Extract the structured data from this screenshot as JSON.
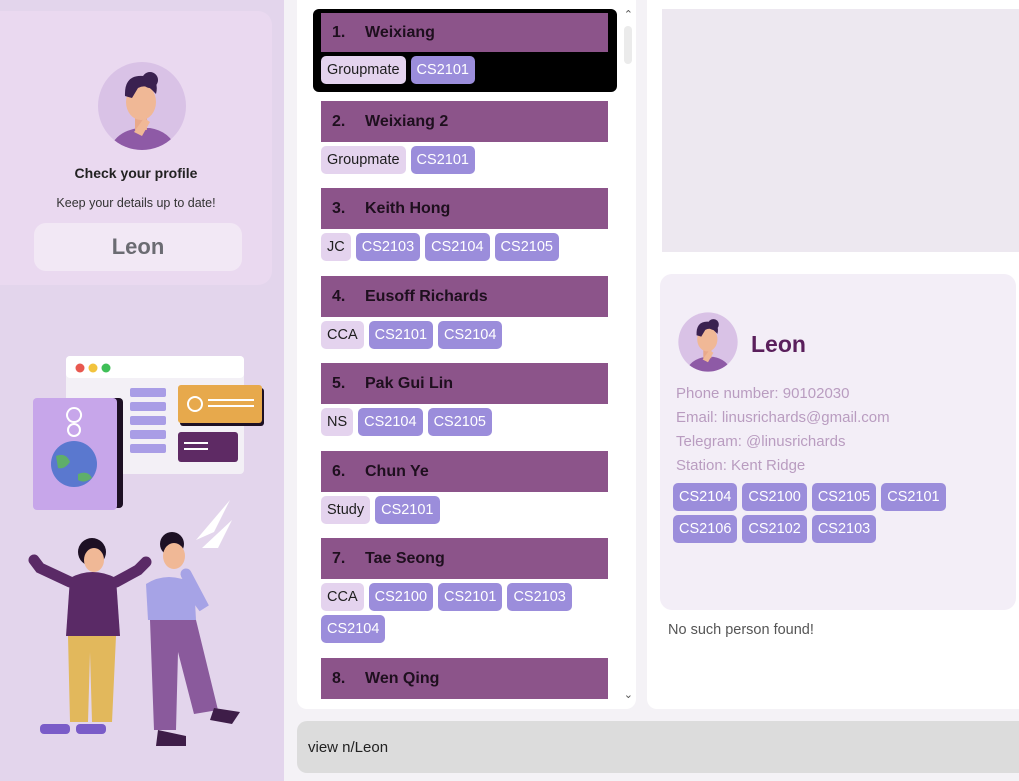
{
  "profile": {
    "heading": "Check your profile",
    "subtitle": "Keep your details up to date!",
    "name": "Leon"
  },
  "persons": [
    {
      "index": "1.",
      "name": "Weixiang",
      "tags": [
        {
          "text": "Groupmate",
          "kind": "text"
        },
        {
          "text": "CS2101",
          "kind": "mod"
        }
      ]
    },
    {
      "index": "2.",
      "name": "Weixiang 2",
      "tags": [
        {
          "text": "Groupmate",
          "kind": "text"
        },
        {
          "text": "CS2101",
          "kind": "mod"
        }
      ]
    },
    {
      "index": "3.",
      "name": "Keith Hong",
      "tags": [
        {
          "text": "JC",
          "kind": "text"
        },
        {
          "text": "CS2103",
          "kind": "mod"
        },
        {
          "text": "CS2104",
          "kind": "mod"
        },
        {
          "text": "CS2105",
          "kind": "mod"
        }
      ]
    },
    {
      "index": "4.",
      "name": "Eusoff Richards",
      "tags": [
        {
          "text": "CCA",
          "kind": "text"
        },
        {
          "text": "CS2101",
          "kind": "mod"
        },
        {
          "text": "CS2104",
          "kind": "mod"
        }
      ]
    },
    {
      "index": "5.",
      "name": "Pak Gui Lin",
      "tags": [
        {
          "text": "NS",
          "kind": "text"
        },
        {
          "text": "CS2104",
          "kind": "mod"
        },
        {
          "text": "CS2105",
          "kind": "mod"
        }
      ]
    },
    {
      "index": "6.",
      "name": "Chun Ye",
      "tags": [
        {
          "text": "Study",
          "kind": "text"
        },
        {
          "text": "CS2101",
          "kind": "mod"
        }
      ]
    },
    {
      "index": "7.",
      "name": "Tae Seong",
      "tags": [
        {
          "text": "CCA",
          "kind": "text"
        },
        {
          "text": "CS2100",
          "kind": "mod"
        },
        {
          "text": "CS2101",
          "kind": "mod"
        },
        {
          "text": "CS2103",
          "kind": "mod"
        },
        {
          "text": "CS2104",
          "kind": "mod"
        }
      ]
    },
    {
      "index": "8.",
      "name": "Wen Qing",
      "tags": []
    }
  ],
  "detail": {
    "name": "Leon",
    "phone": "Phone number: 90102030",
    "email": "Email: linusrichards@gmail.com",
    "telegram": "Telegram: @linusrichards",
    "station": "Station: Kent Ridge",
    "tags": [
      "CS2104",
      "CS2100",
      "CS2105",
      "CS2101",
      "CS2106",
      "CS2102",
      "CS2103"
    ]
  },
  "status": "No such person found!",
  "command": {
    "value": "view n/Leon"
  },
  "icons": {
    "scroll_up": "chevron-up-icon",
    "scroll_down": "chevron-down-icon"
  },
  "colors": {
    "card_bar": "#8c548a",
    "module_tag": "#9b8ddb",
    "text_tag": "#e4d3ee",
    "sidebar": "#e3d5ec",
    "detail_name": "#5a1f5c"
  }
}
